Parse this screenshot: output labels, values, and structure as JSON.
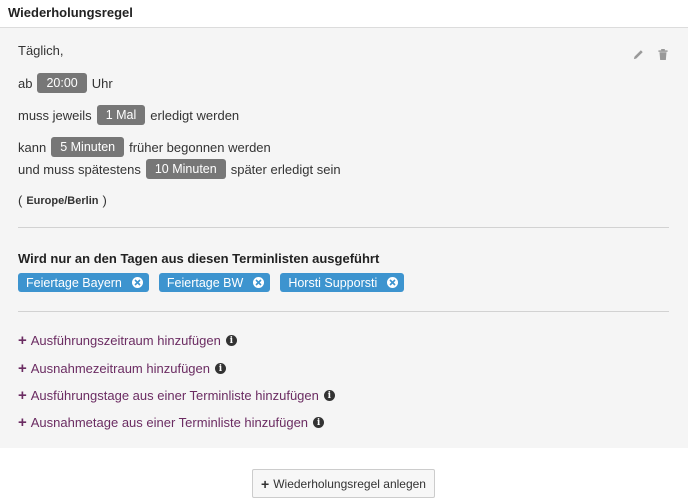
{
  "header": {
    "title": "Wiederholungsregel"
  },
  "rule": {
    "frequency": "Täglich,",
    "at_prefix": "ab",
    "at_time": "20:00",
    "at_suffix": "Uhr",
    "times_prefix": "muss jeweils",
    "times_value": "1 Mal",
    "times_suffix": "erledigt werden",
    "early_prefix": "kann",
    "early_value": "5 Minuten",
    "early_suffix": "früher begonnen werden",
    "late_prefix": "und muss spätestens",
    "late_value": "10 Minuten",
    "late_suffix": "später erledigt sein",
    "tz_open": "(",
    "timezone": "Europe/Berlin",
    "tz_close": ")"
  },
  "actions": {
    "edit_icon": "pencil-icon",
    "delete_icon": "trash-icon"
  },
  "lists_section": {
    "title": "Wird nur an den Tagen aus diesen Terminlisten ausgeführt",
    "chips": [
      {
        "label": "Feiertage Bayern"
      },
      {
        "label": "Feiertage BW"
      },
      {
        "label": "Horsti Supporsti"
      }
    ]
  },
  "links": [
    {
      "label": "Ausführungszeitraum hinzufügen"
    },
    {
      "label": "Ausnahmezeitraum hinzufügen"
    },
    {
      "label": "Ausführungstage aus einer Terminliste hinzufügen"
    },
    {
      "label": "Ausnahmetage aus einer Terminliste hinzufügen"
    }
  ],
  "bottom_button": {
    "label": "Wiederholungsregel anlegen"
  },
  "colors": {
    "accent_link": "#6b2c62",
    "chip": "#3d94cf",
    "tag": "#777777"
  }
}
